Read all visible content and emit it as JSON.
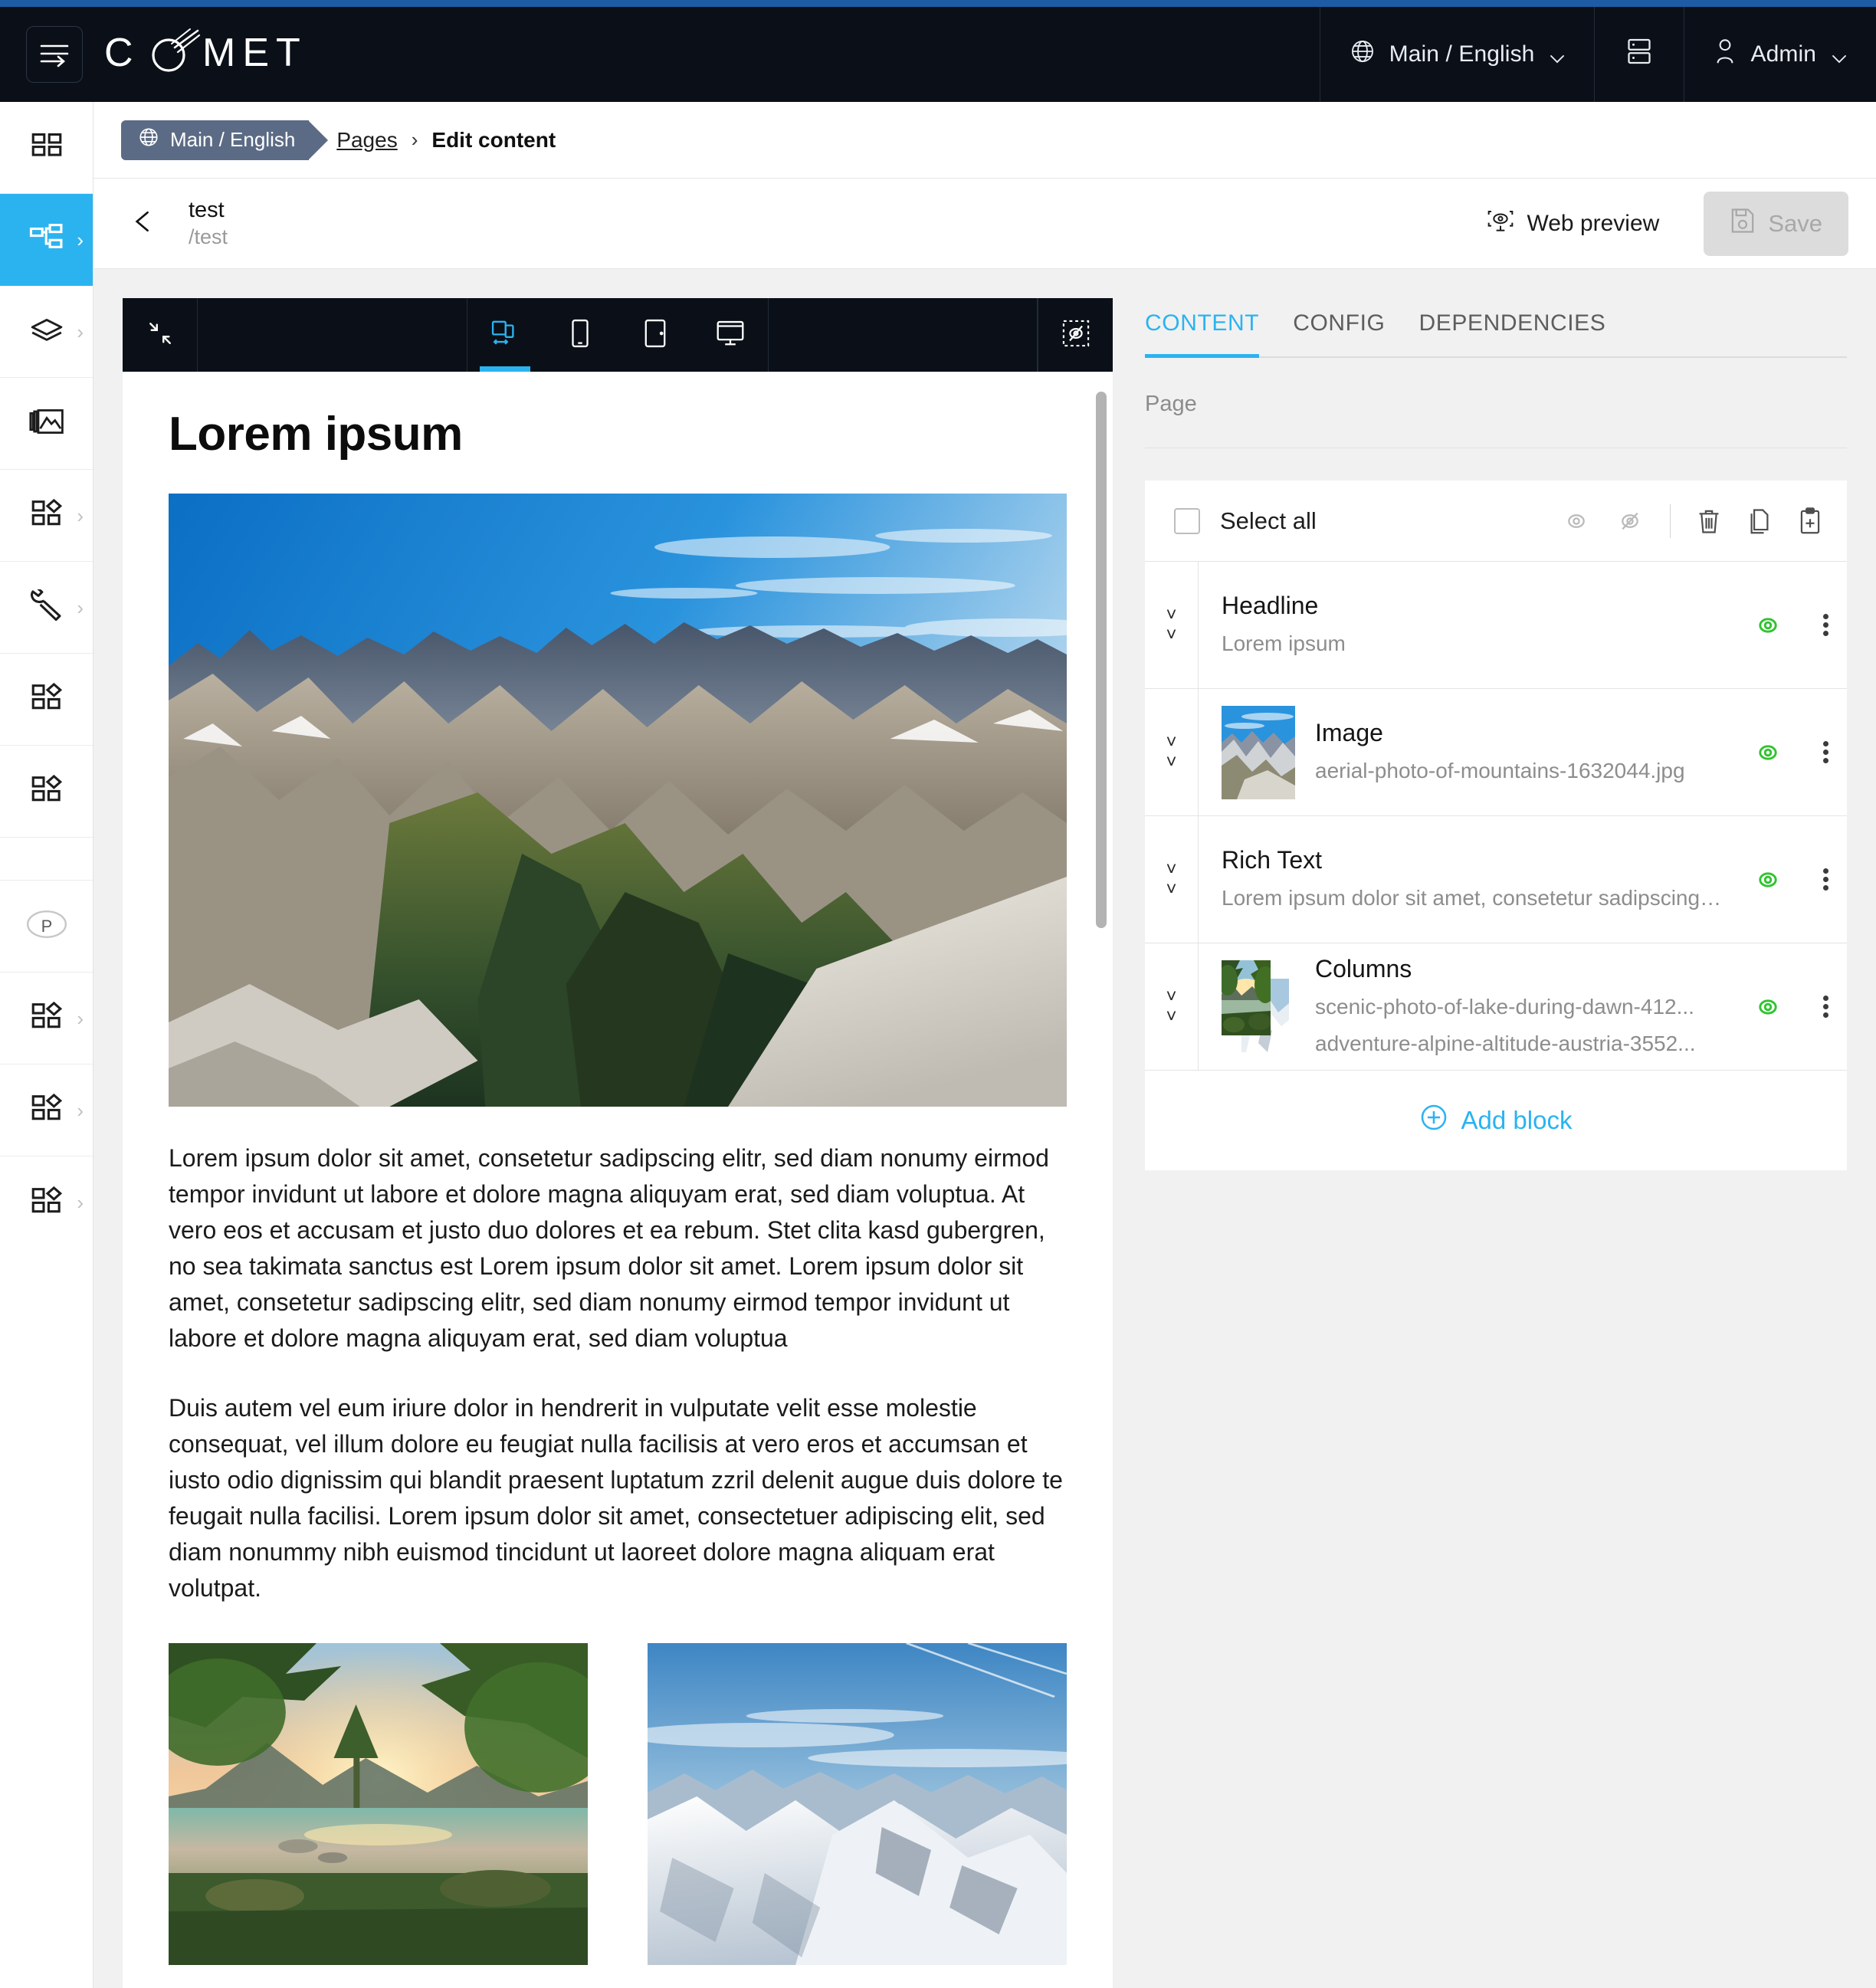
{
  "topbar": {
    "brand": "COMET",
    "menu_icon": "hamburger-arrow-icon",
    "site_selector": {
      "label": "Main / English",
      "icon": "globe-icon",
      "chevron": "chevron-down-icon"
    },
    "layout_icon": "panel-layout-icon",
    "user": {
      "label": "Admin",
      "icon": "user-icon",
      "chevron": "chevron-down-icon"
    }
  },
  "breadcrumb": {
    "scope_chip": "Main / English",
    "scope_icon": "globe-icon",
    "link": "Pages",
    "separator": "›",
    "current": "Edit content"
  },
  "page_header": {
    "back_icon": "arrow-left-icon",
    "title": "test",
    "slug": "/test",
    "web_preview": {
      "label": "Web preview",
      "icon": "web-preview-icon"
    },
    "save": {
      "label": "Save",
      "icon": "save-disk-icon",
      "disabled": true
    }
  },
  "rail": {
    "items": [
      {
        "name": "dashboard",
        "icon": "grid-blocks-icon",
        "active": false,
        "has_arrow": false
      },
      {
        "name": "pages",
        "icon": "sitemap-icon",
        "active": true,
        "has_arrow": true
      },
      {
        "name": "layers",
        "icon": "layers-icon",
        "active": false,
        "has_arrow": true
      },
      {
        "name": "assets",
        "icon": "image-stack-icon",
        "active": false,
        "has_arrow": false
      },
      {
        "name": "blocks-1",
        "icon": "grid-diamond-icon",
        "active": false,
        "has_arrow": true
      },
      {
        "name": "tools",
        "icon": "wrench-icon",
        "active": false,
        "has_arrow": true
      },
      {
        "name": "blocks-2",
        "icon": "grid-diamond-icon",
        "active": false,
        "has_arrow": false
      },
      {
        "name": "blocks-3",
        "icon": "grid-diamond-icon",
        "active": false,
        "has_arrow": false
      },
      {
        "name": "project-badge",
        "icon": "letter-p-badge-icon",
        "active": false,
        "has_arrow": false
      },
      {
        "name": "blocks-4",
        "icon": "grid-diamond-icon",
        "active": false,
        "has_arrow": true
      },
      {
        "name": "blocks-5",
        "icon": "grid-diamond-icon",
        "active": false,
        "has_arrow": true
      },
      {
        "name": "blocks-6",
        "icon": "grid-diamond-icon",
        "active": false,
        "has_arrow": true
      }
    ]
  },
  "preview_toolbar": {
    "expand_icon": "collapse-arrows-icon",
    "devices": [
      {
        "name": "responsive",
        "icon": "responsive-icon",
        "active": true
      },
      {
        "name": "mobile",
        "icon": "mobile-icon",
        "active": false
      },
      {
        "name": "tablet",
        "icon": "tablet-icon",
        "active": false
      },
      {
        "name": "desktop",
        "icon": "desktop-icon",
        "active": false
      }
    ],
    "visibility_icon": "hidden-outline-icon"
  },
  "preview": {
    "heading": "Lorem ipsum",
    "hero_alt": "aerial photo of mountains",
    "paragraph_1": "Lorem ipsum dolor sit amet, consetetur sadipscing elitr, sed diam nonumy eirmod tempor invidunt ut labore et dolore magna aliquyam erat, sed diam voluptua. At vero eos et accusam et justo duo dolores et ea rebum. Stet clita kasd gubergren, no sea takimata sanctus est Lorem ipsum dolor sit amet. Lorem ipsum dolor sit amet, consetetur sadipscing elitr, sed diam nonumy eirmod tempor invidunt ut labore et dolore magna aliquyam erat, sed diam voluptua",
    "paragraph_2": "Duis autem vel eum iriure dolor in hendrerit in vulputate velit esse molestie consequat, vel illum dolore eu feugiat nulla facilisis at vero eros et accumsan et iusto odio dignissim qui blandit praesent luptatum zzril delenit augue duis dolore te feugait nulla facilisi. Lorem ipsum dolor sit amet, consectetuer adipiscing elit, sed diam nonummy nibh euismod tincidunt ut laoreet dolore magna aliquam erat volutpat.",
    "column_1_alt": "scenic photo of lake during dawn",
    "column_2_alt": "adventure alpine altitude austria"
  },
  "side_panel": {
    "tabs": [
      {
        "label": "CONTENT",
        "active": true
      },
      {
        "label": "CONFIG",
        "active": false
      },
      {
        "label": "DEPENDENCIES",
        "active": false
      }
    ],
    "section_label": "Page",
    "select_all": {
      "label": "Select all",
      "checked": false,
      "actions": [
        {
          "name": "show-blocks",
          "icon": "eye-icon"
        },
        {
          "name": "hide-blocks",
          "icon": "eye-off-icon"
        },
        {
          "name": "delete-blocks",
          "icon": "trash-icon"
        },
        {
          "name": "copy-blocks",
          "icon": "copy-icon"
        },
        {
          "name": "paste-block",
          "icon": "clipboard-plus-icon"
        }
      ]
    },
    "blocks": [
      {
        "title": "Headline",
        "subtitle": "Lorem ipsum",
        "subtitle_2": "",
        "thumbs": 0,
        "visible_icon": "eye-icon",
        "menu_icon": "kebab-menu-icon"
      },
      {
        "title": "Image",
        "subtitle": "aerial-photo-of-mountains-1632044.jpg",
        "subtitle_2": "",
        "thumbs": 1,
        "visible_icon": "eye-icon",
        "menu_icon": "kebab-menu-icon"
      },
      {
        "title": "Rich Text",
        "subtitle": "Lorem ipsum dolor sit amet, consetetur sadipscing ...",
        "subtitle_2": "",
        "thumbs": 0,
        "visible_icon": "eye-icon",
        "menu_icon": "kebab-menu-icon"
      },
      {
        "title": "Columns",
        "subtitle": "scenic-photo-of-lake-during-dawn-412...",
        "subtitle_2": "adventure-alpine-altitude-austria-3552...",
        "thumbs": 2,
        "visible_icon": "eye-icon",
        "menu_icon": "kebab-menu-icon"
      }
    ],
    "add_block": {
      "label": "Add block",
      "icon": "plus-circle-icon"
    }
  },
  "colors": {
    "accent": "#2bb3f0",
    "topbar_bg": "#0b1018",
    "accent_line": "#1d5ba4",
    "crumb_chip": "#5c6b85",
    "visible_green": "#2fc42f",
    "page_bg": "#f1f1f1"
  }
}
